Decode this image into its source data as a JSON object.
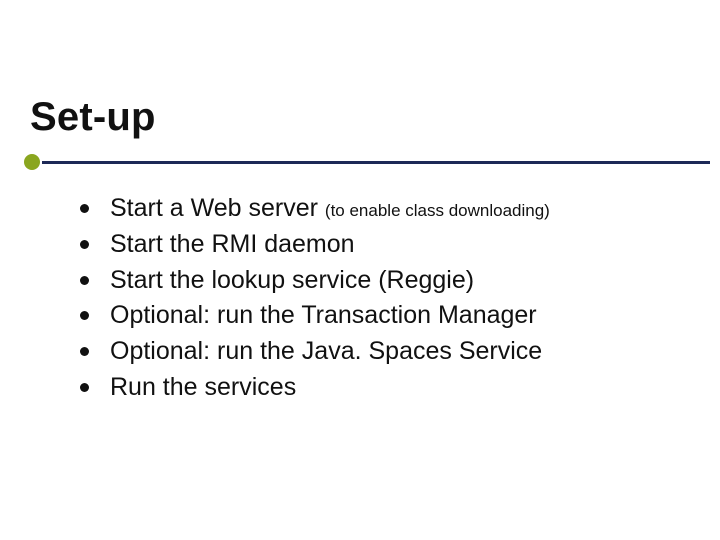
{
  "title": "Set-up",
  "items": [
    {
      "main": "Start a Web server ",
      "sub": "(to enable class downloading)"
    },
    {
      "main": "Start the RMI daemon",
      "sub": ""
    },
    {
      "main": "Start the lookup service (Reggie)",
      "sub": ""
    },
    {
      "main": "Optional: run the Transaction Manager",
      "sub": ""
    },
    {
      "main": "Optional: run the Java. Spaces Service",
      "sub": ""
    },
    {
      "main": "Run the services",
      "sub": ""
    }
  ]
}
